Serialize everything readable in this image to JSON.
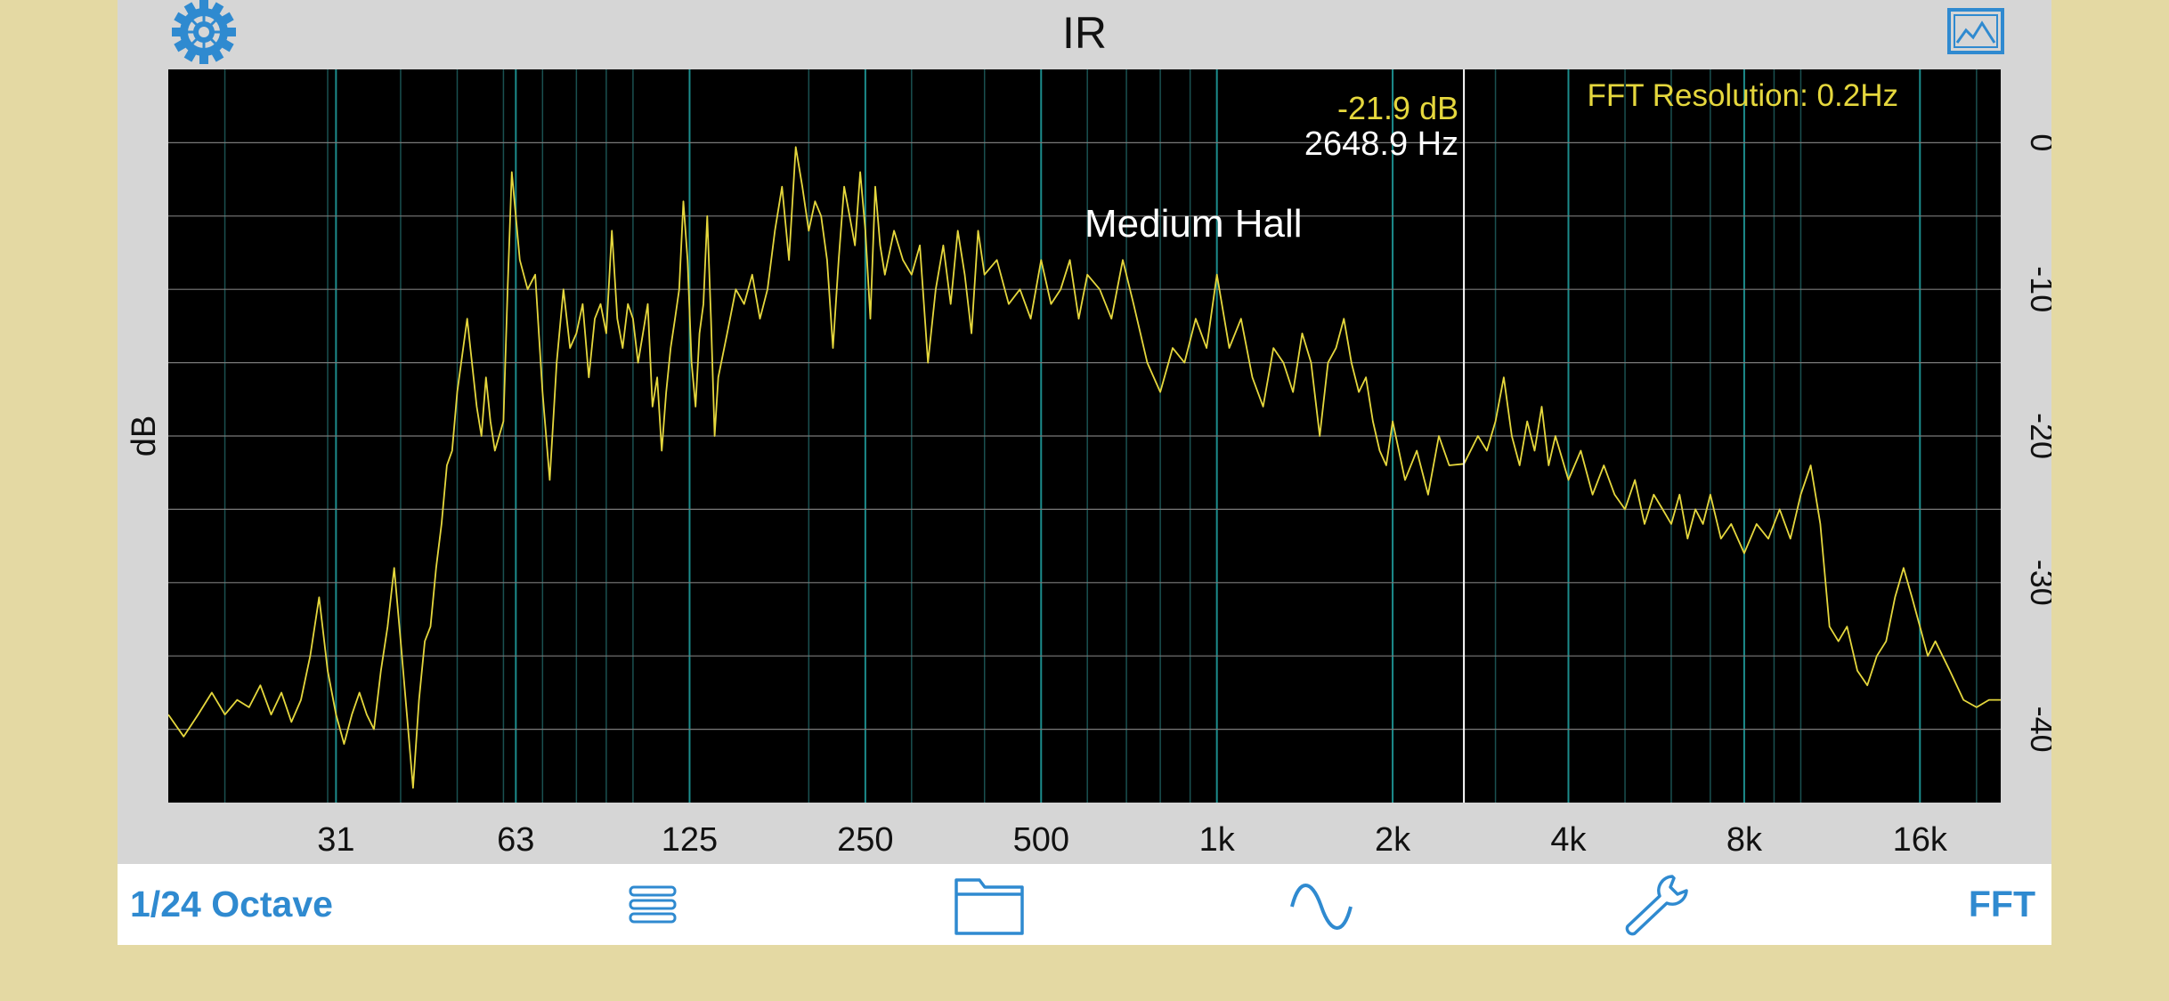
{
  "window": {
    "title": "IR"
  },
  "toolbar": {
    "resolution_label": "1/24 Octave",
    "mode_label": "FFT"
  },
  "icons": {
    "settings": "gear-icon",
    "export_image": "image-icon",
    "list": "list-icon",
    "open_file": "folder-icon",
    "signal": "sine-wave-icon",
    "tools": "wrench-icon"
  },
  "colors": {
    "trace": "#e5d73d",
    "grid_vertical": "#1c8c8c",
    "grid_horizontal": "#7a7a7a",
    "accent": "#2f8ad0",
    "cursor": "#ffffff"
  },
  "plot": {
    "trace_name": "Medium Hall",
    "fft_resolution_label": "FFT Resolution:  0.2Hz",
    "cursor": {
      "db_readout": "-21.9 dB",
      "hz_readout": "2648.9 Hz",
      "freq_hz": 2648.9
    }
  },
  "chart_data": {
    "type": "line",
    "xscale": "log",
    "xlim": [
      16,
      22000
    ],
    "ylim": [
      -45,
      5
    ],
    "ylabel": "dB",
    "xlabel": "",
    "x_ticks": [
      {
        "value": 31,
        "label": "31"
      },
      {
        "value": 63,
        "label": "63"
      },
      {
        "value": 125,
        "label": "125"
      },
      {
        "value": 250,
        "label": "250"
      },
      {
        "value": 500,
        "label": "500"
      },
      {
        "value": 1000,
        "label": "1k"
      },
      {
        "value": 2000,
        "label": "2k"
      },
      {
        "value": 4000,
        "label": "4k"
      },
      {
        "value": 8000,
        "label": "8k"
      },
      {
        "value": 16000,
        "label": "16k"
      }
    ],
    "y_ticks": [
      {
        "value": 0,
        "label": "0"
      },
      {
        "value": -10,
        "label": "-10"
      },
      {
        "value": -20,
        "label": "-20"
      },
      {
        "value": -30,
        "label": "-30"
      },
      {
        "value": -40,
        "label": "-40"
      }
    ],
    "grid": true,
    "series": [
      {
        "name": "Medium Hall",
        "points": [
          [
            16,
            -39
          ],
          [
            17,
            -40.5
          ],
          [
            18,
            -39
          ],
          [
            19,
            -37.5
          ],
          [
            20,
            -39
          ],
          [
            21,
            -38
          ],
          [
            22,
            -38.5
          ],
          [
            23,
            -37
          ],
          [
            24,
            -39
          ],
          [
            25,
            -37.5
          ],
          [
            26,
            -39.5
          ],
          [
            27,
            -38
          ],
          [
            28,
            -35
          ],
          [
            29,
            -31
          ],
          [
            30,
            -36
          ],
          [
            31,
            -39
          ],
          [
            32,
            -41
          ],
          [
            33,
            -39
          ],
          [
            34,
            -37.5
          ],
          [
            35,
            -39
          ],
          [
            36,
            -40
          ],
          [
            37,
            -36
          ],
          [
            38,
            -33
          ],
          [
            39,
            -29
          ],
          [
            40,
            -34
          ],
          [
            41,
            -39
          ],
          [
            42,
            -44
          ],
          [
            43,
            -38
          ],
          [
            44,
            -34
          ],
          [
            45,
            -33
          ],
          [
            46,
            -29
          ],
          [
            47,
            -26
          ],
          [
            48,
            -22
          ],
          [
            49,
            -21
          ],
          [
            50,
            -17
          ],
          [
            52,
            -12
          ],
          [
            54,
            -18
          ],
          [
            55,
            -20
          ],
          [
            56,
            -16
          ],
          [
            57,
            -19
          ],
          [
            58,
            -21
          ],
          [
            60,
            -19
          ],
          [
            61,
            -10
          ],
          [
            62,
            -2
          ],
          [
            63,
            -5
          ],
          [
            64,
            -8
          ],
          [
            66,
            -10
          ],
          [
            68,
            -9
          ],
          [
            70,
            -17
          ],
          [
            72,
            -23
          ],
          [
            74,
            -15
          ],
          [
            76,
            -10
          ],
          [
            78,
            -14
          ],
          [
            80,
            -13
          ],
          [
            82,
            -11
          ],
          [
            84,
            -16
          ],
          [
            86,
            -12
          ],
          [
            88,
            -11
          ],
          [
            90,
            -13
          ],
          [
            92,
            -6
          ],
          [
            94,
            -12
          ],
          [
            96,
            -14
          ],
          [
            98,
            -11
          ],
          [
            100,
            -12
          ],
          [
            102,
            -15
          ],
          [
            104,
            -13
          ],
          [
            106,
            -11
          ],
          [
            108,
            -18
          ],
          [
            110,
            -16
          ],
          [
            112,
            -21
          ],
          [
            114,
            -17
          ],
          [
            116,
            -14
          ],
          [
            118,
            -12
          ],
          [
            120,
            -10
          ],
          [
            122,
            -4
          ],
          [
            124,
            -8
          ],
          [
            126,
            -15
          ],
          [
            128,
            -18
          ],
          [
            130,
            -13
          ],
          [
            132,
            -11
          ],
          [
            134,
            -5
          ],
          [
            136,
            -12
          ],
          [
            138,
            -20
          ],
          [
            140,
            -16
          ],
          [
            145,
            -13
          ],
          [
            150,
            -10
          ],
          [
            155,
            -11
          ],
          [
            160,
            -9
          ],
          [
            165,
            -12
          ],
          [
            170,
            -10
          ],
          [
            175,
            -6
          ],
          [
            180,
            -3
          ],
          [
            185,
            -8
          ],
          [
            190,
            -0.3
          ],
          [
            195,
            -3
          ],
          [
            200,
            -6
          ],
          [
            205,
            -4
          ],
          [
            210,
            -5
          ],
          [
            215,
            -8
          ],
          [
            220,
            -14
          ],
          [
            225,
            -8
          ],
          [
            230,
            -3
          ],
          [
            235,
            -5
          ],
          [
            240,
            -7
          ],
          [
            245,
            -2
          ],
          [
            250,
            -6
          ],
          [
            255,
            -12
          ],
          [
            260,
            -3
          ],
          [
            265,
            -7
          ],
          [
            270,
            -9
          ],
          [
            280,
            -6
          ],
          [
            290,
            -8
          ],
          [
            300,
            -9
          ],
          [
            310,
            -7
          ],
          [
            320,
            -15
          ],
          [
            330,
            -10
          ],
          [
            340,
            -7
          ],
          [
            350,
            -11
          ],
          [
            360,
            -6
          ],
          [
            370,
            -9
          ],
          [
            380,
            -13
          ],
          [
            390,
            -6
          ],
          [
            400,
            -9
          ],
          [
            420,
            -8
          ],
          [
            440,
            -11
          ],
          [
            460,
            -10
          ],
          [
            480,
            -12
          ],
          [
            500,
            -8
          ],
          [
            520,
            -11
          ],
          [
            540,
            -10
          ],
          [
            560,
            -8
          ],
          [
            580,
            -12
          ],
          [
            600,
            -9
          ],
          [
            630,
            -10
          ],
          [
            660,
            -12
          ],
          [
            690,
            -8
          ],
          [
            720,
            -11
          ],
          [
            760,
            -15
          ],
          [
            800,
            -17
          ],
          [
            840,
            -14
          ],
          [
            880,
            -15
          ],
          [
            920,
            -12
          ],
          [
            960,
            -14
          ],
          [
            1000,
            -9
          ],
          [
            1050,
            -14
          ],
          [
            1100,
            -12
          ],
          [
            1150,
            -16
          ],
          [
            1200,
            -18
          ],
          [
            1250,
            -14
          ],
          [
            1300,
            -15
          ],
          [
            1350,
            -17
          ],
          [
            1400,
            -13
          ],
          [
            1450,
            -15
          ],
          [
            1500,
            -20
          ],
          [
            1550,
            -15
          ],
          [
            1600,
            -14
          ],
          [
            1650,
            -12
          ],
          [
            1700,
            -15
          ],
          [
            1750,
            -17
          ],
          [
            1800,
            -16
          ],
          [
            1850,
            -19
          ],
          [
            1900,
            -21
          ],
          [
            1950,
            -22
          ],
          [
            2000,
            -19
          ],
          [
            2100,
            -23
          ],
          [
            2200,
            -21
          ],
          [
            2300,
            -24
          ],
          [
            2400,
            -20
          ],
          [
            2500,
            -22
          ],
          [
            2650,
            -21.9
          ],
          [
            2800,
            -20
          ],
          [
            2900,
            -21
          ],
          [
            3000,
            -19
          ],
          [
            3100,
            -16
          ],
          [
            3200,
            -20
          ],
          [
            3300,
            -22
          ],
          [
            3400,
            -19
          ],
          [
            3500,
            -21
          ],
          [
            3600,
            -18
          ],
          [
            3700,
            -22
          ],
          [
            3800,
            -20
          ],
          [
            4000,
            -23
          ],
          [
            4200,
            -21
          ],
          [
            4400,
            -24
          ],
          [
            4600,
            -22
          ],
          [
            4800,
            -24
          ],
          [
            5000,
            -25
          ],
          [
            5200,
            -23
          ],
          [
            5400,
            -26
          ],
          [
            5600,
            -24
          ],
          [
            5800,
            -25
          ],
          [
            6000,
            -26
          ],
          [
            6200,
            -24
          ],
          [
            6400,
            -27
          ],
          [
            6600,
            -25
          ],
          [
            6800,
            -26
          ],
          [
            7000,
            -24
          ],
          [
            7300,
            -27
          ],
          [
            7600,
            -26
          ],
          [
            8000,
            -28
          ],
          [
            8400,
            -26
          ],
          [
            8800,
            -27
          ],
          [
            9200,
            -25
          ],
          [
            9600,
            -27
          ],
          [
            10000,
            -24
          ],
          [
            10400,
            -22
          ],
          [
            10800,
            -26
          ],
          [
            11200,
            -33
          ],
          [
            11600,
            -34
          ],
          [
            12000,
            -33
          ],
          [
            12500,
            -36
          ],
          [
            13000,
            -37
          ],
          [
            13500,
            -35
          ],
          [
            14000,
            -34
          ],
          [
            14500,
            -31
          ],
          [
            15000,
            -29
          ],
          [
            15500,
            -31
          ],
          [
            16000,
            -33
          ],
          [
            16500,
            -35
          ],
          [
            17000,
            -34
          ],
          [
            18000,
            -36
          ],
          [
            19000,
            -38
          ],
          [
            20000,
            -38.5
          ],
          [
            21000,
            -38
          ],
          [
            22000,
            -38
          ]
        ]
      }
    ]
  }
}
